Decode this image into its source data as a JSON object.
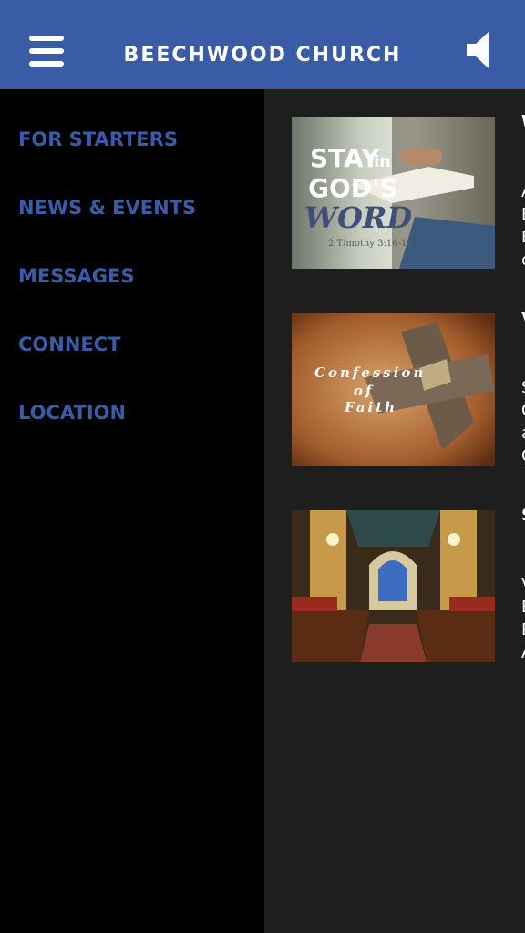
{
  "header": {
    "title": "BEECHWOOD CHURCH",
    "menu_icon": "hamburger-menu-icon",
    "sound_icon": "speaker-icon"
  },
  "nav": {
    "items": [
      {
        "label": "FOR STARTERS"
      },
      {
        "label": "NEWS & EVENTS"
      },
      {
        "label": "MESSAGES"
      },
      {
        "label": "CONNECT"
      },
      {
        "label": "LOCATION"
      }
    ]
  },
  "cards": [
    {
      "image_lines": {
        "l1": "STAY",
        "l1b": "in",
        "l2": "GOD'S",
        "l3": "WORD",
        "ref": "2 Timothy 3:16-17"
      },
      "peek": {
        "title": "W",
        "body": [
          "A",
          "E",
          "E",
          "c"
        ]
      }
    },
    {
      "image_lines": {
        "l1": "Confession",
        "l2": "of",
        "l3": "Faith"
      },
      "peek": {
        "title": "V",
        "body": [
          "S",
          "C",
          "a",
          "C"
        ]
      }
    },
    {
      "peek": {
        "title": "S",
        "body": [
          "V",
          "E",
          "E",
          "A"
        ]
      }
    }
  ],
  "colors": {
    "header_bg": "#3a5ca6",
    "nav_text": "#3a5ca6",
    "drawer_bg": "#000000",
    "content_bg": "#1e1e1e"
  }
}
